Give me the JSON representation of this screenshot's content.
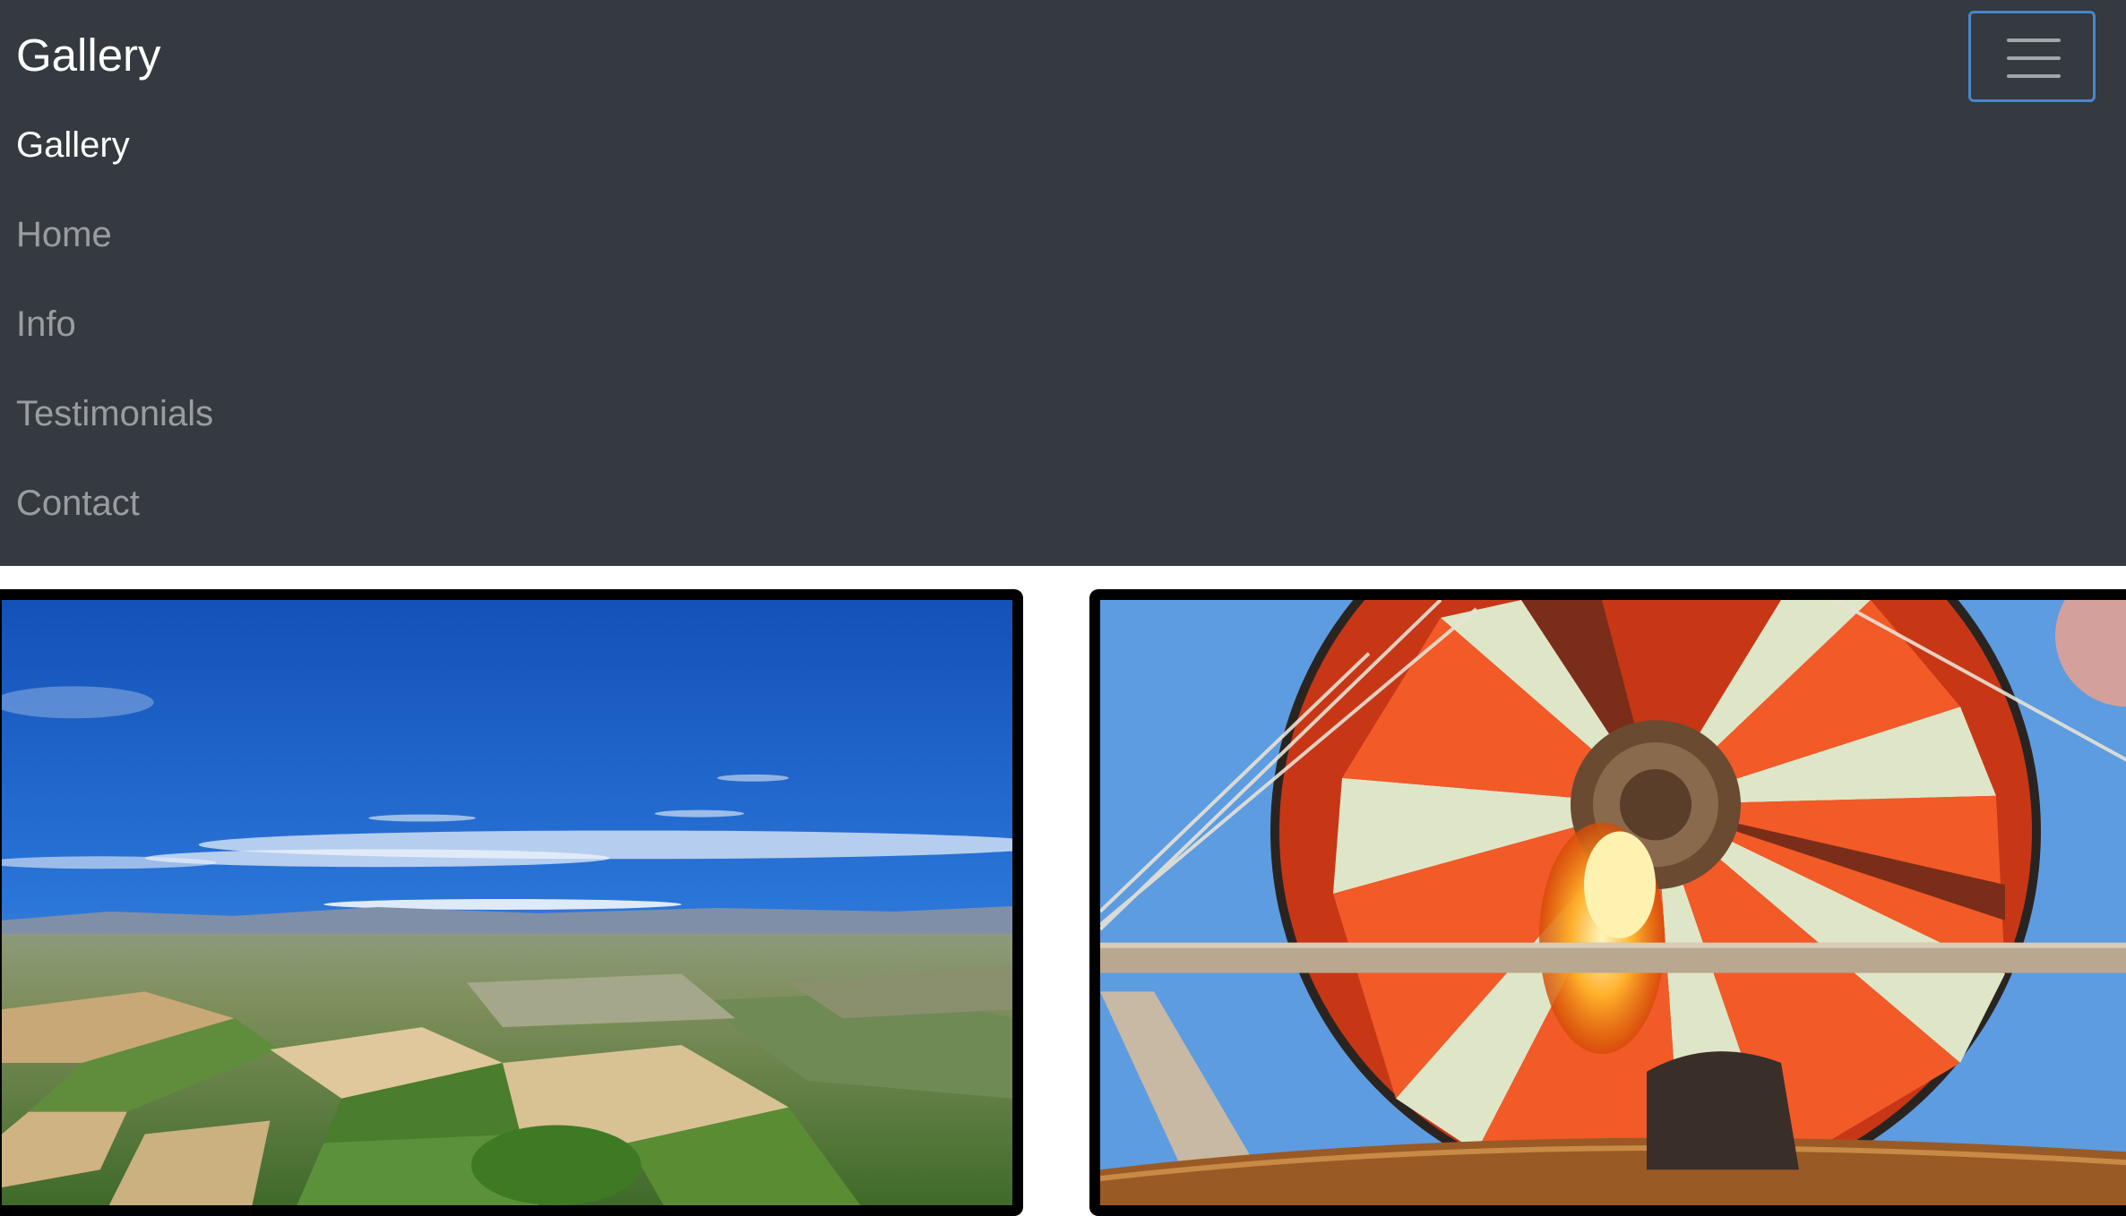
{
  "navbar": {
    "brand": "Gallery",
    "links": [
      {
        "label": "Gallery",
        "active": true
      },
      {
        "label": "Home",
        "active": false
      },
      {
        "label": "Info",
        "active": false
      },
      {
        "label": "Testimonials",
        "active": false
      },
      {
        "label": "Contact",
        "active": false
      }
    ],
    "toggler_icon": "hamburger-menu-icon"
  },
  "gallery": {
    "images": [
      {
        "subject": "aerial landscape with blue sky and farm fields"
      },
      {
        "subject": "hot air balloon interior with burner flame"
      }
    ]
  },
  "colors": {
    "navbar_bg": "#343a40",
    "link_active": "#ffffff",
    "link_inactive": "rgba(255,255,255,0.5)",
    "toggler_border": "#4a86c8",
    "photo_border": "#000000"
  }
}
